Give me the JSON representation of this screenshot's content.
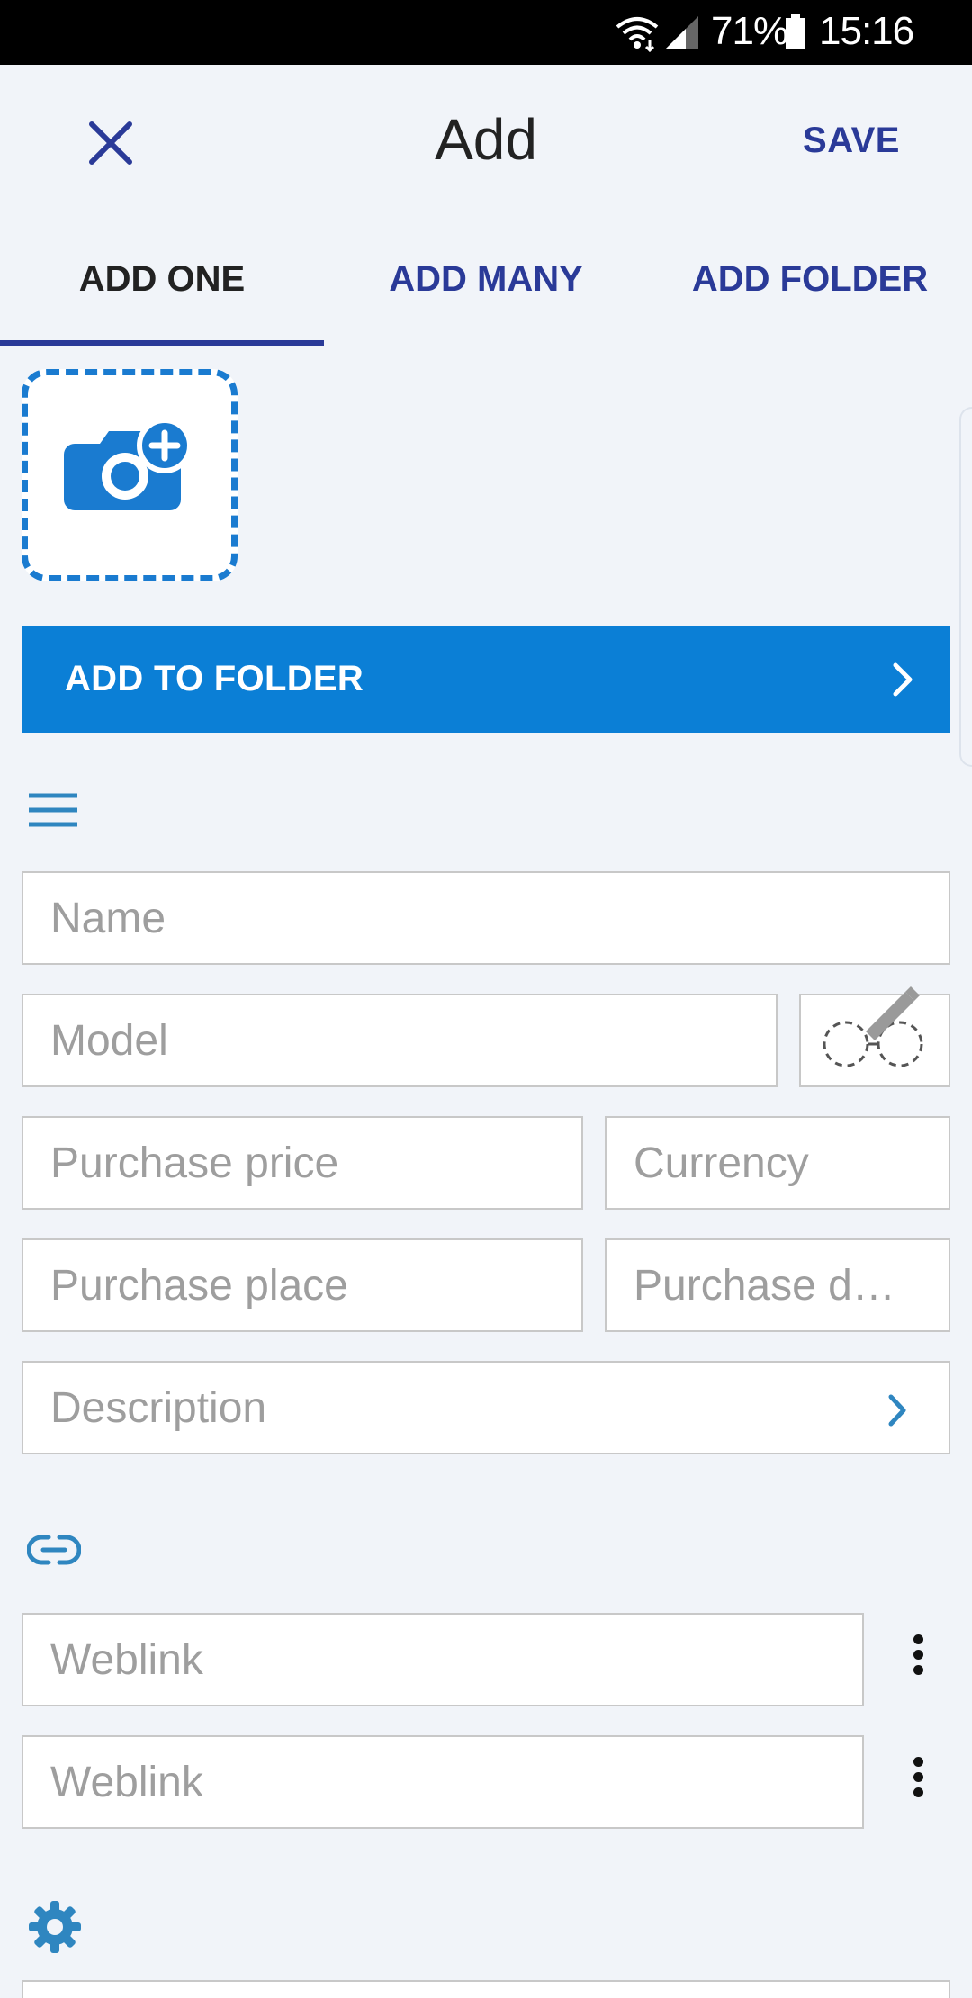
{
  "status_bar": {
    "battery_percent": "71%",
    "time": "15:16",
    "icons": [
      "wifi-icon",
      "signal-icon",
      "battery-icon"
    ]
  },
  "app_bar": {
    "title": "Add",
    "save_label": "SAVE",
    "close_icon": "close-icon"
  },
  "tabs": [
    {
      "label": "ADD ONE",
      "active": true
    },
    {
      "label": "ADD MANY",
      "active": false
    },
    {
      "label": "ADD FOLDER",
      "active": false
    }
  ],
  "photo": {
    "icon": "add-photo-camera-icon"
  },
  "folder_bar": {
    "label": "ADD TO FOLDER",
    "icon": "chevron-right-icon"
  },
  "sections": {
    "details_icon": "menu-lines-icon",
    "links_icon": "link-icon",
    "settings_icon": "gear-icon"
  },
  "fields": {
    "name": {
      "placeholder": "Name",
      "value": ""
    },
    "model": {
      "placeholder": "Model",
      "value": ""
    },
    "purchase_price": {
      "placeholder": "Purchase price",
      "value": ""
    },
    "currency": {
      "placeholder": "Currency",
      "value": ""
    },
    "purchase_place": {
      "placeholder": "Purchase place",
      "value": ""
    },
    "purchase_date": {
      "placeholder": "Purchase d…",
      "value": ""
    },
    "description": {
      "placeholder": "Description",
      "value": ""
    },
    "weblink_1": {
      "placeholder": "Weblink",
      "value": ""
    },
    "weblink_2": {
      "placeholder": "Weblink",
      "value": ""
    }
  },
  "colors": {
    "accent": "#2a3a98",
    "primary": "#0b7fd6",
    "background": "#f1f4f9"
  }
}
